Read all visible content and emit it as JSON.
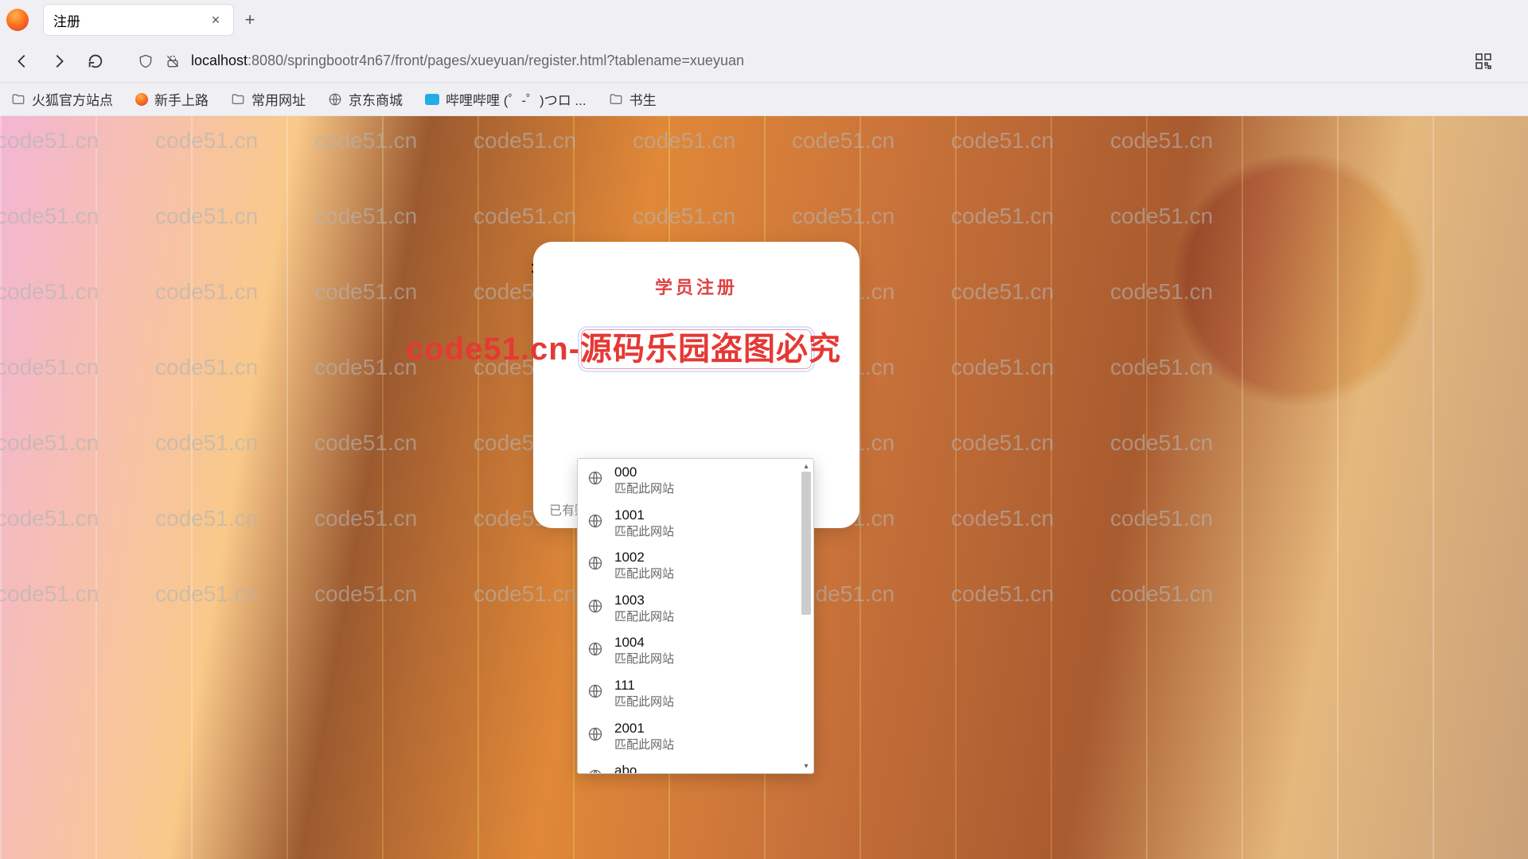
{
  "browser": {
    "tab_title": "注册",
    "url_host": "localhost",
    "url_port_path": ":8080/springbootr4n67/front/pages/xueyuan/register.html?tablename=xueyuan",
    "bookmarks": [
      {
        "icon": "folder",
        "label": "火狐官方站点"
      },
      {
        "icon": "ff",
        "label": "新手上路"
      },
      {
        "icon": "folder",
        "label": "常用网址"
      },
      {
        "icon": "globe",
        "label": "京东商城"
      },
      {
        "icon": "bili",
        "label": "哔哩哔哩 (゜-゜)つロ ..."
      },
      {
        "icon": "folder",
        "label": "书生"
      }
    ]
  },
  "card": {
    "title": "学员注册",
    "input_placeholder": "",
    "already_label": "已有账"
  },
  "autocomplete": {
    "match_label": "匹配此网站",
    "items": [
      {
        "value": "000"
      },
      {
        "value": "1001"
      },
      {
        "value": "1002"
      },
      {
        "value": "1003"
      },
      {
        "value": "1004"
      },
      {
        "value": "111"
      },
      {
        "value": "2001"
      },
      {
        "value": "abo"
      }
    ]
  },
  "watermark_text": "code51.cn",
  "big_watermark": "code51.cn-源码乐园盗图必究",
  "caret_glyph": "⇕"
}
